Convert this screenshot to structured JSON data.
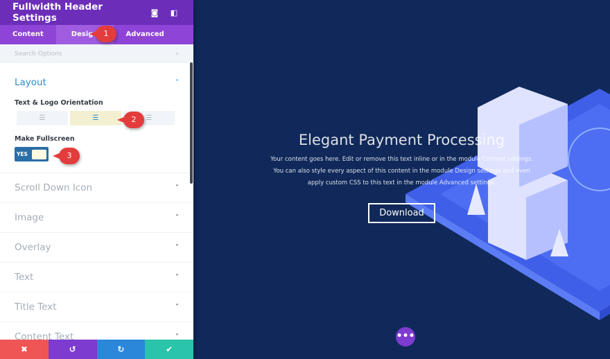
{
  "panel": {
    "title": "Fullwidth Header Settings",
    "icons": [
      "fullscreen-icon",
      "sidebar-toggle-icon"
    ],
    "tabs": [
      {
        "label": "Content"
      },
      {
        "label": "Design"
      },
      {
        "label": "Advanced"
      }
    ],
    "search_placeholder": "Search Options",
    "layout": {
      "title": "Layout",
      "orientation_label": "Text & Logo Orientation",
      "orientation_options": [
        "left",
        "center",
        "right"
      ],
      "orientation_selected": "center",
      "fullscreen_label": "Make Fullscreen",
      "fullscreen_value": "YES"
    },
    "sections": [
      "Scroll Down Icon",
      "Image",
      "Overlay",
      "Text",
      "Title Text",
      "Content Text"
    ],
    "callouts": [
      "1",
      "2",
      "3"
    ],
    "footer": {
      "buttons": [
        "discard",
        "undo",
        "redo",
        "save"
      ],
      "colors": [
        "#ef5555",
        "#7e3bd0",
        "#2b87da",
        "#29c4a9"
      ]
    }
  },
  "hero": {
    "title": "Elegant Payment Processing",
    "body": "Your content goes here. Edit or remove this text inline or in the module Content settings. You can also style every aspect of this content in the module Design settings and even apply custom CSS to this text in the module Advanced settings.",
    "button": "Download",
    "background": "#10295a"
  },
  "builder": {
    "more_button": "•••"
  }
}
